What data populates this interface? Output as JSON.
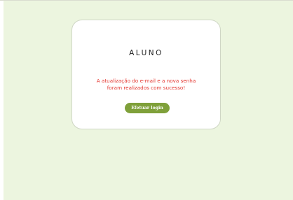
{
  "card": {
    "title": "ALUNO",
    "message_line_1": "A atualização do e-mail e a nova senha",
    "message_line_2": "foram realizados com sucesso!",
    "login_button_label": "Efetuar login"
  },
  "colors": {
    "page_background": "#ecf5df",
    "message_text": "#e3332c",
    "button_background": "#7fa03a"
  }
}
